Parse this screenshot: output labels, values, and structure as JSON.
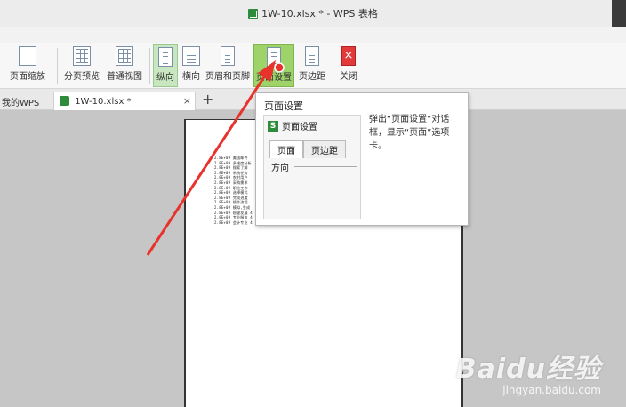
{
  "window": {
    "title": "1W-10.xlsx * - WPS 表格"
  },
  "ribbon": {
    "page_zoom": "页面缩放",
    "page_break_preview": "分页预览",
    "normal_view": "普通视图",
    "portrait": "纵向",
    "landscape": "横向",
    "header_footer": "页眉和页脚",
    "page_setup": "页面设置",
    "margins": "页边距",
    "close": "关闭"
  },
  "tabs": {
    "my_wps": "我的WPS",
    "file_tab": "1W-10.xlsx *",
    "close": "×",
    "add": "+"
  },
  "tooltip": {
    "title": "页面设置",
    "dialog_title": "页面设置",
    "tab_page": "页面",
    "tab_margins": "页边距",
    "orientation": "方向",
    "description": "弹出“页面设置”对话框，显示“页面”选项卡。"
  },
  "sheet_rows": [
    "2.8E+09  美国邮件",
    "2.8E+09  多维度分析",
    "2.8E+09  搜索了解",
    "2.8E+09  系统任务",
    "2.8E+09  农村用户",
    "2.8E+09  采购需求",
    "2.8E+09  职位工作",
    "2.8E+09  选择模式",
    "2.8E+09  完成进度",
    "2.8E+09  操作流程",
    "2.8E+09  模拟,生成",
    "2.8E+09  稳健发展  4  1.1E+08  协调统一共同发展  一级评级  不具体",
    "2.8E+09  专业服务  4  1.1E+08  多部门协同推进  一级评级  不具体",
    "2.8E+09  会计专业  4  1.1E+08  业务负责人员  一级评级  不具体"
  ],
  "watermark": {
    "logo": "Baidu经验",
    "url": "jingyan.baidu.com"
  }
}
